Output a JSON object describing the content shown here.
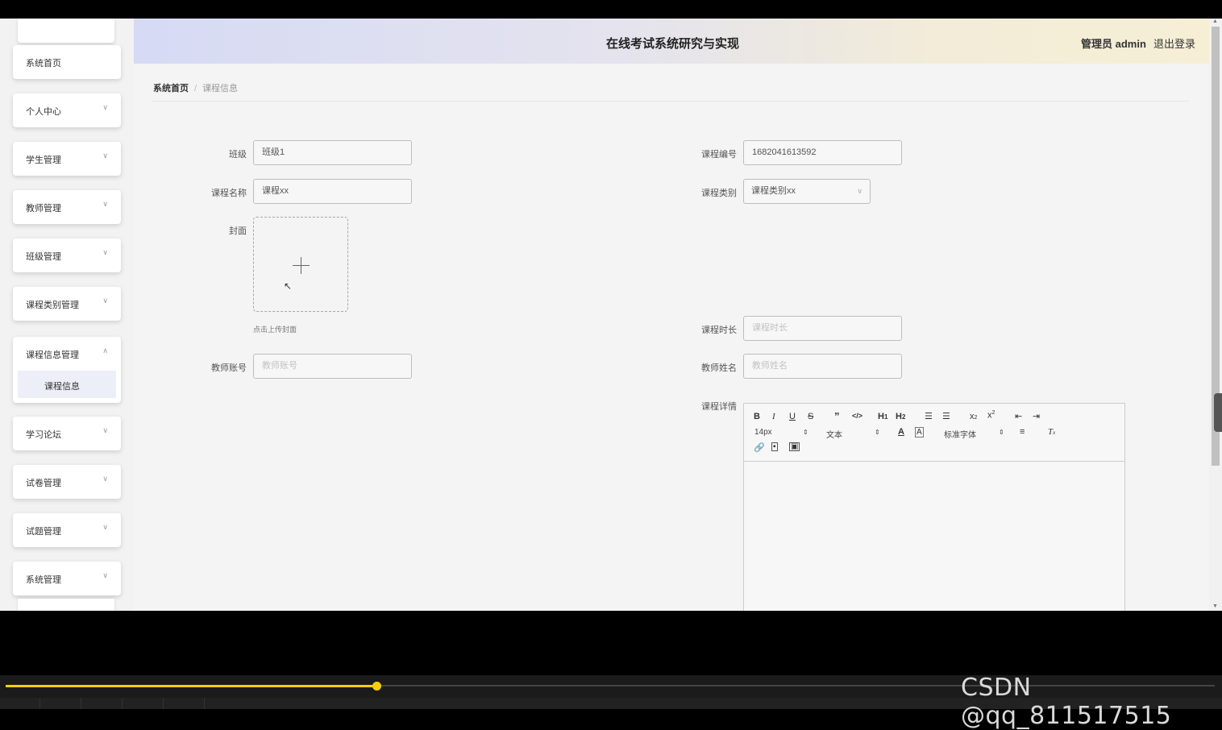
{
  "header": {
    "title": "在线考试系统研究与实现",
    "user": "管理员 admin",
    "logout": "退出登录"
  },
  "sidebar": {
    "items": [
      {
        "label": "系统首页"
      },
      {
        "label": "个人中心"
      },
      {
        "label": "学生管理"
      },
      {
        "label": "教师管理"
      },
      {
        "label": "班级管理"
      },
      {
        "label": "课程类别管理"
      },
      {
        "label": "课程信息管理",
        "expanded": true,
        "children": [
          {
            "label": "课程信息"
          }
        ]
      },
      {
        "label": "学习论坛"
      },
      {
        "label": "试卷管理"
      },
      {
        "label": "试题管理"
      },
      {
        "label": "系统管理"
      }
    ]
  },
  "breadcrumb": {
    "home": "系统首页",
    "current": "课程信息"
  },
  "form": {
    "class_label": "班级",
    "class_value": "班级1",
    "course_no_label": "课程编号",
    "course_no_value": "1682041613592",
    "course_name_label": "课程名称",
    "course_name_value": "课程xx",
    "course_type_label": "课程类别",
    "course_type_value": "课程类别xx",
    "cover_label": "封面",
    "cover_hint": "点击上传封面",
    "duration_label": "课程时长",
    "duration_placeholder": "课程时长",
    "teacher_account_label": "教师账号",
    "teacher_account_placeholder": "教师账号",
    "teacher_name_label": "教师姓名",
    "teacher_name_placeholder": "教师姓名",
    "detail_label": "课程详情"
  },
  "editor": {
    "font_size": "14px",
    "header_select": "文本",
    "font_family": "标准字体"
  },
  "watermark": "CSDN @qq_811517515"
}
